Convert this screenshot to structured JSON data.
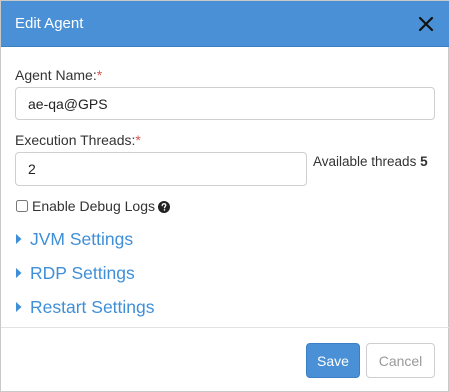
{
  "dialog": {
    "title": "Edit Agent"
  },
  "fields": {
    "agent_name_label": "Agent Name:",
    "agent_name_value": "ae-qa@GPS",
    "threads_label": "Execution Threads:",
    "threads_value": "2",
    "required_mark": "*",
    "available_label": "Available threads",
    "available_value": "5"
  },
  "debug": {
    "label": "Enable Debug Logs",
    "checked": false
  },
  "sections": [
    {
      "label": "JVM Settings"
    },
    {
      "label": "RDP Settings"
    },
    {
      "label": "Restart Settings"
    }
  ],
  "footer": {
    "save_label": "Save",
    "cancel_label": "Cancel"
  },
  "colors": {
    "header": "#4a90d6",
    "section_link": "#3f8fd8",
    "required": "#d9534f"
  },
  "icons": {
    "close": "close-icon",
    "help": "question-circle-icon",
    "expand": "caret-right-icon"
  }
}
